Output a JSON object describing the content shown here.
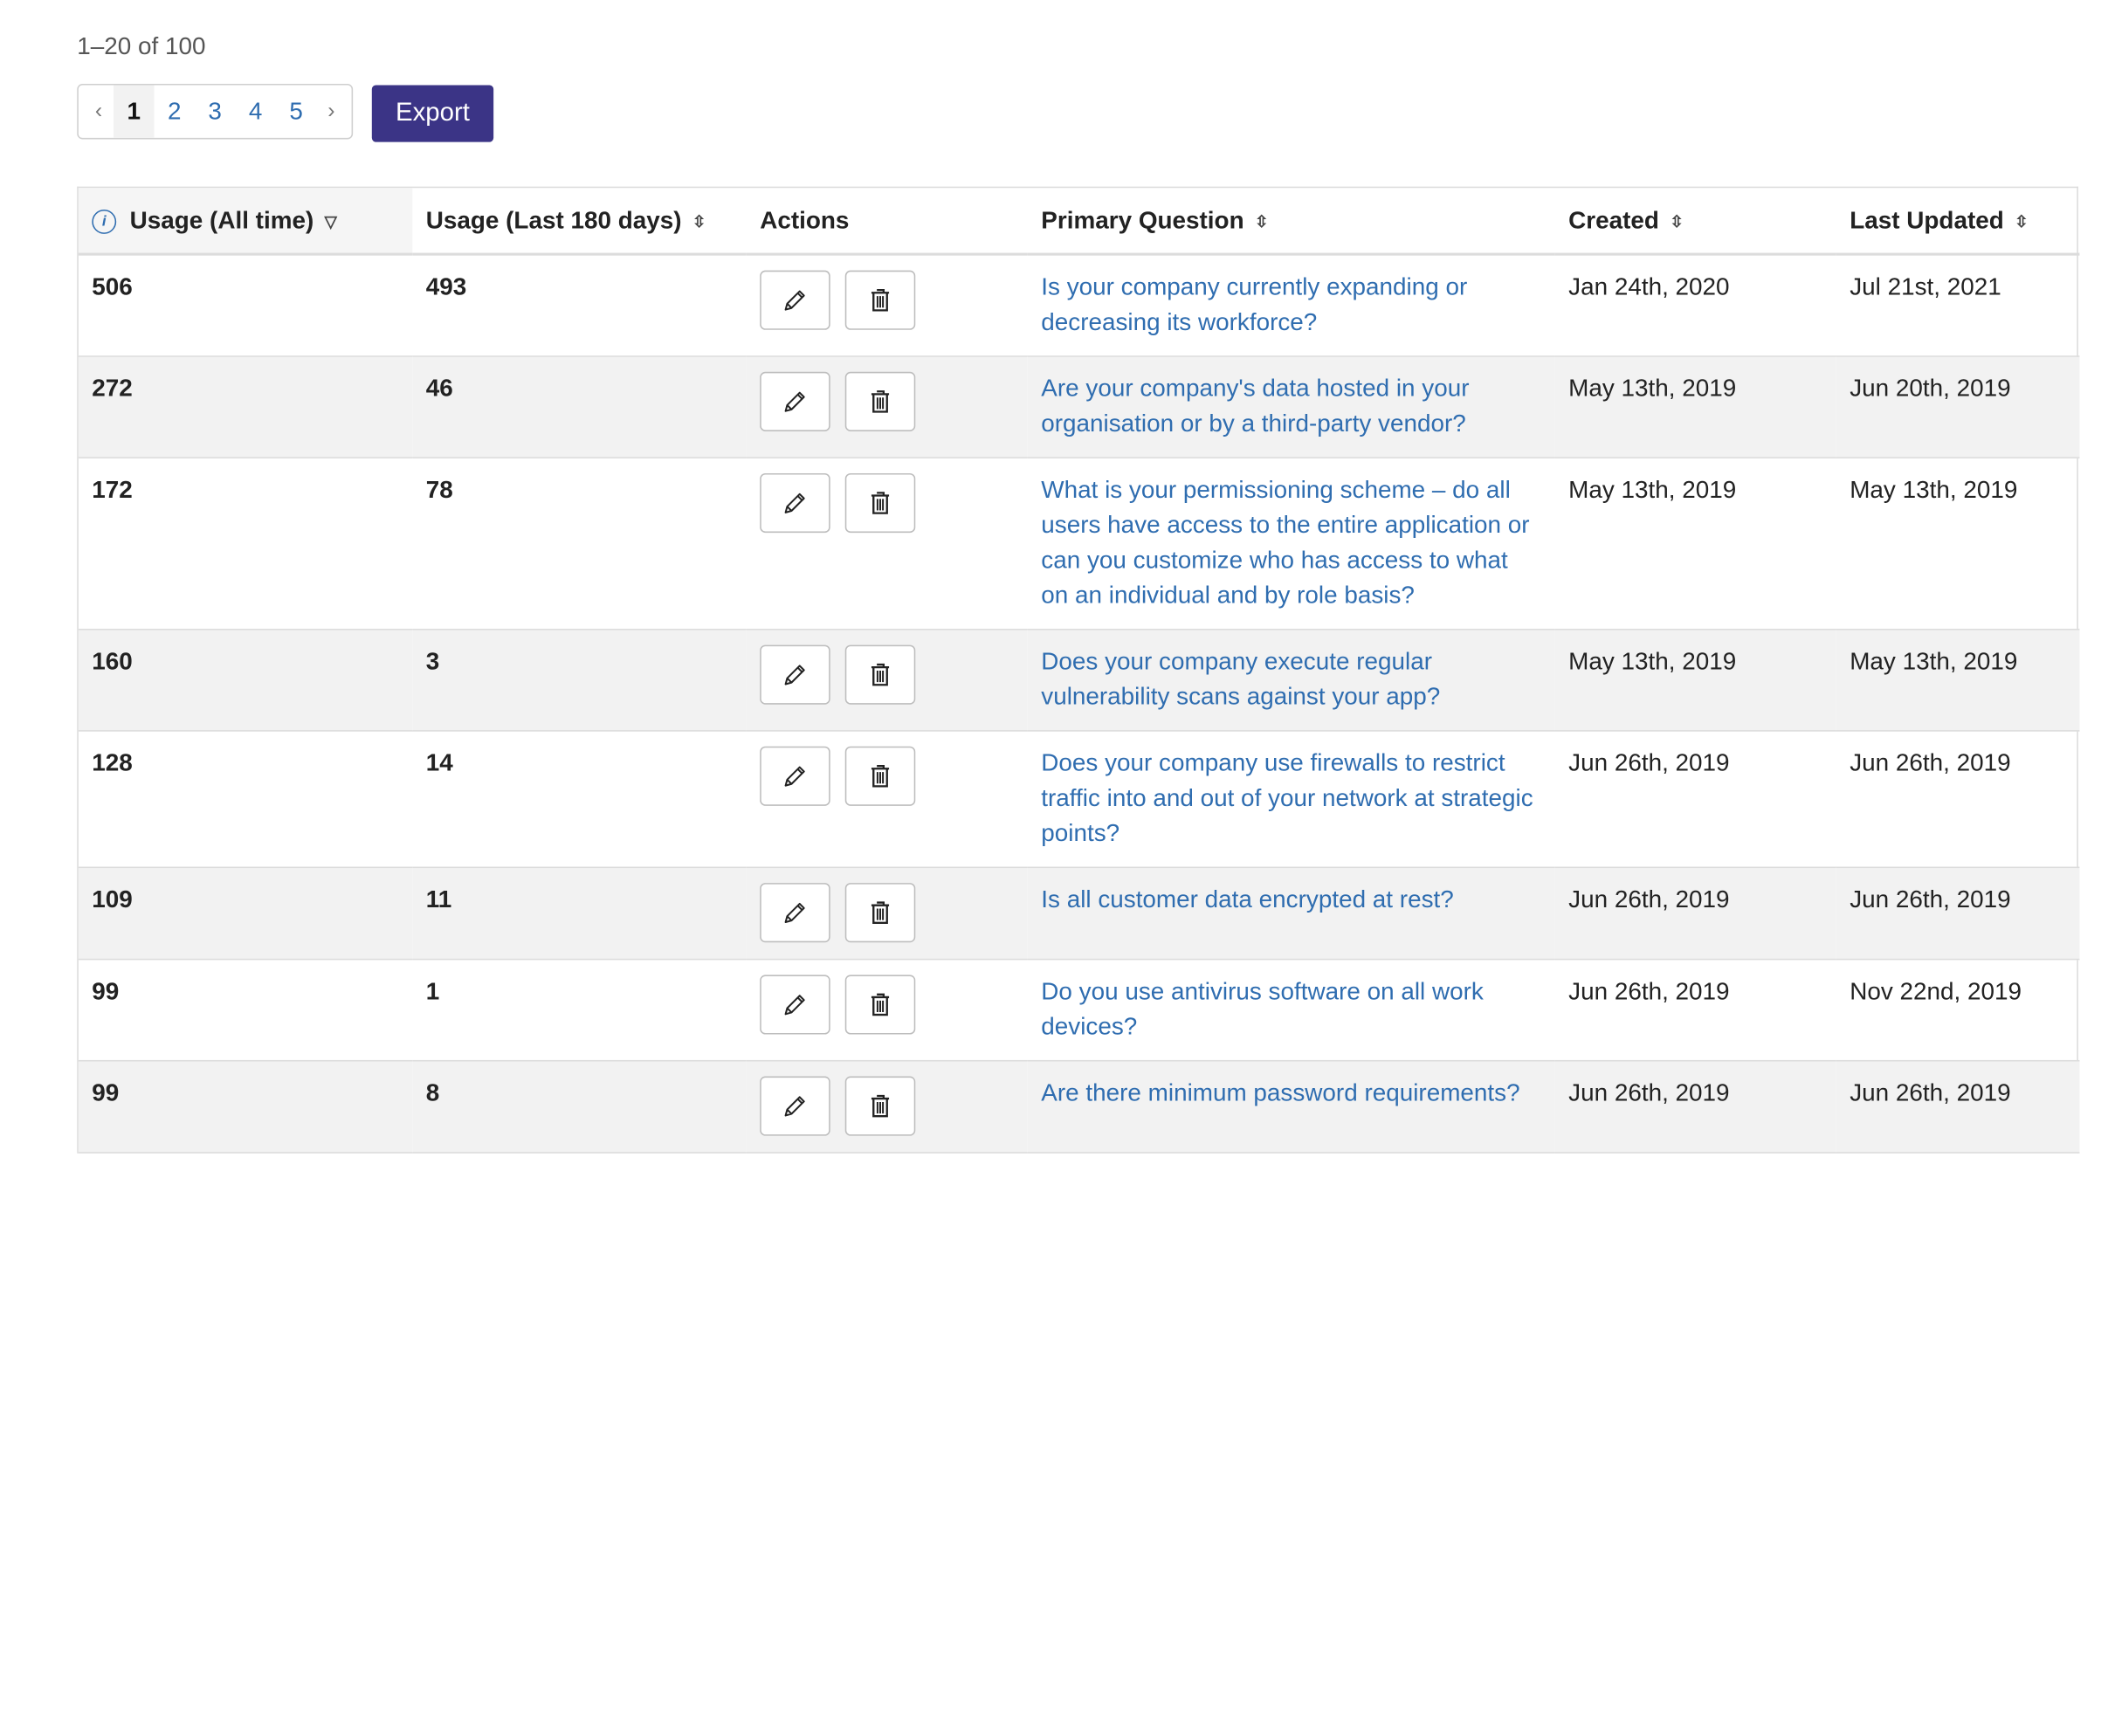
{
  "pagination": {
    "range_text": "1–20 of 100",
    "prev_icon": "chevron-left-icon",
    "next_icon": "chevron-right-icon",
    "pages": [
      "1",
      "2",
      "3",
      "4",
      "5"
    ],
    "current_page": "1"
  },
  "toolbar": {
    "export_label": "Export"
  },
  "table": {
    "columns": [
      {
        "label": "Usage (All time)",
        "sort": "descending",
        "info_icon": true
      },
      {
        "label": "Usage (Last 180 days)",
        "sort": "sortable"
      },
      {
        "label": "Actions",
        "sort": "none"
      },
      {
        "label": "Primary Question",
        "sort": "sortable"
      },
      {
        "label": "Created",
        "sort": "sortable"
      },
      {
        "label": "Last Updated",
        "sort": "sortable"
      }
    ],
    "rows": [
      {
        "usage_all": "506",
        "usage_180": "493",
        "question": "Is your company currently expanding or decreasing its workforce?",
        "created": "Jan 24th, 2020",
        "updated": "Jul 21st, 2021"
      },
      {
        "usage_all": "272",
        "usage_180": "46",
        "question": "Are your company's data hosted in your organisation or by a third-party vendor?",
        "created": "May 13th, 2019",
        "updated": "Jun 20th, 2019"
      },
      {
        "usage_all": "172",
        "usage_180": "78",
        "question": "What is your permissioning scheme – do all users have access to the entire application or can you customize who has access to what on an individual and by role basis?",
        "created": "May 13th, 2019",
        "updated": "May 13th, 2019"
      },
      {
        "usage_all": "160",
        "usage_180": "3",
        "question": "Does your company execute regular vulnerability scans against your app?",
        "created": "May 13th, 2019",
        "updated": "May 13th, 2019"
      },
      {
        "usage_all": "128",
        "usage_180": "14",
        "question": "Does your company use firewalls to restrict traffic into and out of your network at strategic points?",
        "created": "Jun 26th, 2019",
        "updated": "Jun 26th, 2019"
      },
      {
        "usage_all": "109",
        "usage_180": "11",
        "question": "Is all customer data encrypted at rest?",
        "created": "Jun 26th, 2019",
        "updated": "Jun 26th, 2019"
      },
      {
        "usage_all": "99",
        "usage_180": "1",
        "question": "Do you use antivirus software on all work devices?",
        "created": "Jun 26th, 2019",
        "updated": "Nov 22nd, 2019"
      },
      {
        "usage_all": "99",
        "usage_180": "8",
        "question": "Are there minimum password requirements?",
        "created": "Jun 26th, 2019",
        "updated": "Jun 26th, 2019"
      }
    ],
    "row_actions": [
      {
        "name": "edit",
        "icon": "pencil-icon"
      },
      {
        "name": "delete",
        "icon": "trash-icon"
      }
    ]
  },
  "colors": {
    "accent": "#3b3486",
    "link": "#2f6db0",
    "row_alt": "#f2f2f2"
  }
}
